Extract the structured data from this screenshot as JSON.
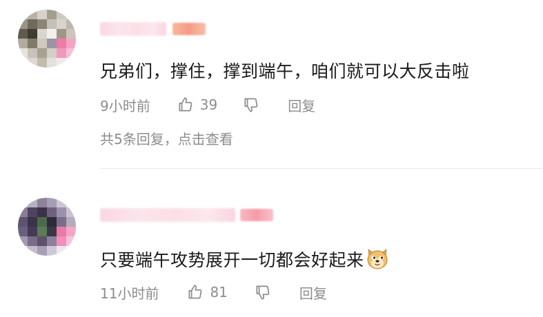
{
  "comments": [
    {
      "text": "兄弟们，撑住，撑到端午，咱们就可以大反击啦",
      "time": "9小时前",
      "likes": "39",
      "reply_label": "回复",
      "replies_summary": "共5条回复，点击查看",
      "icons": [
        "thumbs-up-icon",
        "thumbs-down-icon"
      ]
    },
    {
      "text": "只要端午攻势展开一切都会好起来",
      "time": "11小时前",
      "likes": "81",
      "reply_label": "回复",
      "emoji": "doge-emoji",
      "icons": [
        "thumbs-up-icon",
        "thumbs-down-icon"
      ]
    }
  ],
  "colors": {
    "meta_text": "#8c8c8c",
    "divider": "#e9e9e9"
  }
}
